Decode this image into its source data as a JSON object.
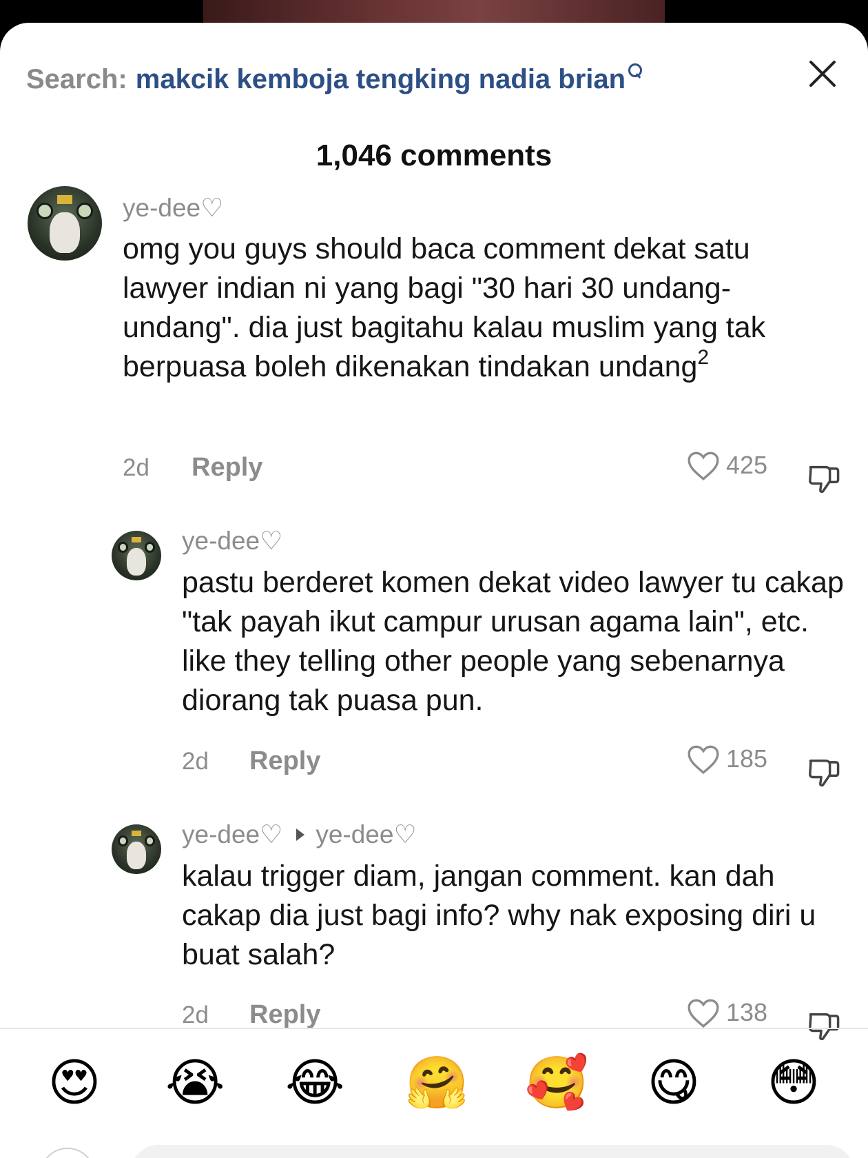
{
  "search": {
    "label": "Search:",
    "query": "makcik kemboja tengking nadia brian"
  },
  "comments_header": "1,046 comments",
  "comments": [
    {
      "username": "ye-dee♡",
      "text_main": "omg you guys should baca comment dekat satu lawyer indian ni yang bagi \"30 hari 30 undang-undang\". dia just bagitahu kalau muslim yang tak berpuasa boleh dikenakan tindakan undang",
      "text_sup": "2",
      "time": "2d",
      "reply_label": "Reply",
      "likes": "425"
    },
    {
      "username": "ye-dee♡",
      "text": "pastu berderet komen dekat video lawyer tu cakap \"tak payah ikut campur urusan agama lain\", etc. like they telling other people yang sebenarnya diorang tak puasa pun.",
      "time": "2d",
      "reply_label": "Reply",
      "likes": "185"
    },
    {
      "username": "ye-dee♡",
      "reply_to": "ye-dee♡",
      "text": "kalau trigger diam, jangan comment. kan dah cakap dia just bagi info? why nak exposing diri u buat salah?",
      "time": "2d",
      "reply_label": "Reply",
      "likes": "138"
    }
  ],
  "emoji_bar": [
    "😍",
    "😭",
    "😂",
    "🤗",
    "🥰",
    "😋",
    "😳"
  ],
  "colors": {
    "search_query": "#2d4f86",
    "muted": "#8c8c8c",
    "text": "#161616"
  }
}
